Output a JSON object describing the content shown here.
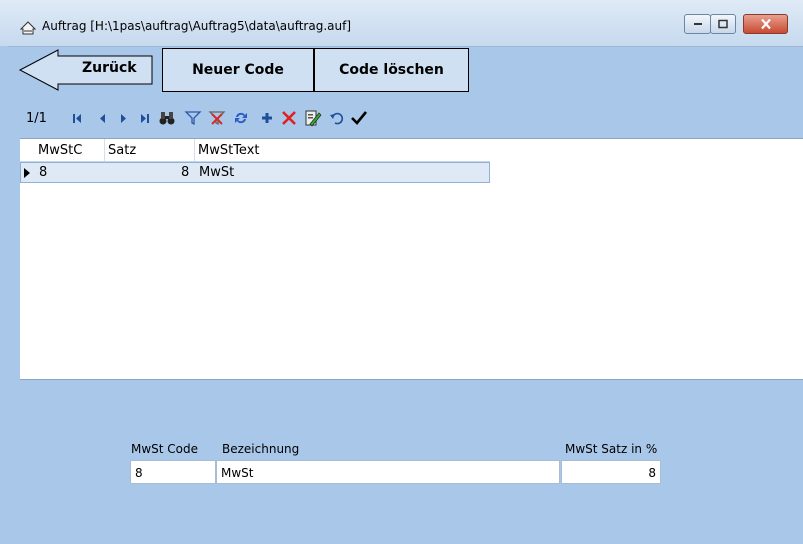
{
  "window": {
    "title": "Auftrag [H:\\1pas\\auftrag\\Auftrag5\\data\\auftrag.auf]"
  },
  "toolbar": {
    "back_label": "Zurück",
    "new_code_label": "Neuer Code",
    "delete_code_label": "Code löschen"
  },
  "navigator": {
    "record_position": "1/1",
    "icons": [
      "first-record-icon",
      "prev-record-icon",
      "next-record-icon",
      "last-record-icon",
      "search-binoculars-icon",
      "filter-icon",
      "clear-filter-icon",
      "refresh-icon",
      "add-record-icon",
      "delete-record-icon",
      "edit-record-icon",
      "undo-icon",
      "confirm-check-icon"
    ]
  },
  "grid": {
    "columns": [
      "MwStC",
      "Satz",
      "MwStText"
    ],
    "rows": [
      {
        "mwstc": "8",
        "satz": "8",
        "mwsttext": "MwSt"
      }
    ]
  },
  "form": {
    "code_label": "MwSt Code",
    "code_value": "8",
    "desc_label": "Bezeichnung",
    "desc_value": "MwSt",
    "rate_label": "MwSt Satz in %",
    "rate_value": "8"
  },
  "colors": {
    "background": "#a9c7e8",
    "button": "#cfe0f3",
    "close_button": "#c84a32",
    "selected_row": "#dfe9f6"
  }
}
